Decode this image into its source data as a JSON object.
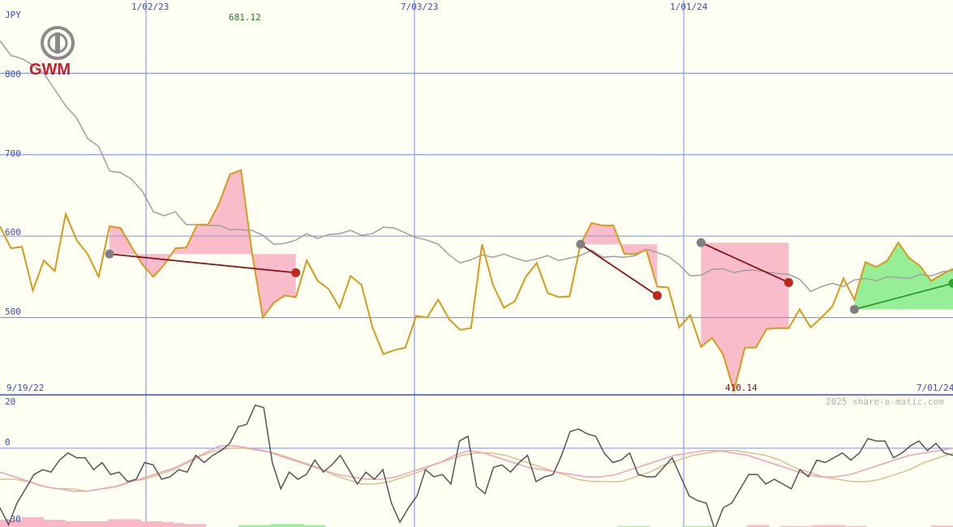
{
  "chart_data": [
    {
      "type": "line",
      "currency": "JPY",
      "x_tick_labels": [
        "1/02/23",
        "7/03/23",
        "1/01/24"
      ],
      "range_start_label": "9/19/22",
      "range_end_label": "7/01/24",
      "y_tick_labels": [
        "800",
        "700",
        "600",
        "500"
      ],
      "ylim": [
        405,
        890
      ],
      "high_label": "681.12",
      "low_label": "410.14",
      "watermark": "2025 share-o-matic.com",
      "grid": true,
      "colors": {
        "price": "#d99a1a",
        "average": "#a0a0a0",
        "gain_fill": "#90ee90",
        "loss_fill": "#f8b8c8",
        "loss_line": "#8b1010",
        "gain_line": "#2a9a2a",
        "grid": "#8a9cf0",
        "axis_text": "#3c4cc0",
        "background": "#fffff4"
      },
      "series": [
        {
          "values": [
            612,
            585,
            587,
            533,
            570,
            557,
            627,
            595,
            578,
            550,
            612,
            610,
            587,
            565,
            550,
            565,
            585,
            586,
            614,
            614,
            640,
            676,
            681,
            580,
            500,
            518,
            527,
            525,
            570,
            545,
            535,
            512,
            551,
            540,
            488,
            455,
            460,
            463,
            502,
            500,
            522,
            498,
            485,
            487,
            590,
            540,
            512,
            520,
            550,
            567,
            530,
            525,
            526,
            590,
            616,
            613,
            613,
            578,
            578,
            583,
            538,
            537,
            488,
            503,
            464,
            475,
            455,
            410,
            463,
            463,
            486,
            487,
            487,
            510,
            488,
            500,
            514,
            548,
            522,
            568,
            562,
            570,
            592,
            573,
            563,
            545,
            553,
            560
          ]
        },
        {
          "values": [
            840,
            822,
            818,
            810,
            800,
            780,
            760,
            745,
            720,
            710,
            680,
            678,
            670,
            655,
            630,
            625,
            630,
            614,
            614,
            613,
            613,
            608,
            608,
            607,
            601,
            590,
            591,
            595,
            603,
            597,
            602,
            603,
            607,
            601,
            603,
            611,
            610,
            604,
            598,
            595,
            590,
            577,
            567,
            571,
            577,
            574,
            578,
            573,
            569,
            572,
            576,
            570,
            573,
            576,
            583,
            574,
            575,
            574,
            576,
            584,
            580,
            575,
            565,
            551,
            552,
            559,
            560,
            555,
            558,
            558,
            556,
            554,
            553,
            547,
            532,
            538,
            542,
            538,
            546,
            548,
            545,
            550,
            549,
            548,
            553,
            551,
            556,
            558
          ]
        }
      ],
      "trades": [
        {
          "entry_index": 10,
          "entry_value": 578,
          "exit_index": 27,
          "exit_value": 555,
          "result": "loss"
        },
        {
          "entry_index": 53,
          "entry_value": 590,
          "exit_index": 60,
          "exit_value": 527,
          "result": "loss"
        },
        {
          "entry_index": 64,
          "entry_value": 592,
          "exit_index": 72,
          "exit_value": 543,
          "result": "loss"
        },
        {
          "entry_index": 78,
          "entry_value": 510,
          "exit_index": 88,
          "exit_value": 542,
          "result": "gain"
        }
      ]
    },
    {
      "type": "line",
      "y_tick_labels": [
        "20",
        "0",
        "-30"
      ],
      "ylim": [
        -33,
        22
      ],
      "colors": {
        "oscillator": "#555555",
        "signal_pink": "#f5a0b8",
        "signal_tan": "#d8c090"
      },
      "series": [
        {
          "values": [
            -25,
            -32,
            -23,
            -17,
            -11,
            -9,
            -10,
            -5,
            -2,
            -4,
            -4,
            -9,
            -6,
            -11,
            -10,
            -14,
            -13,
            -6,
            -7,
            -13,
            -12,
            -9,
            -10,
            -3,
            -6,
            -3,
            -1,
            2,
            9,
            10,
            18,
            17,
            -6,
            -17,
            -10,
            -13,
            -11,
            -5,
            -10,
            -7,
            -3,
            -9,
            -15,
            -10,
            -13,
            -9,
            -23,
            -31,
            -25,
            -20,
            -9,
            -12,
            -11,
            -15,
            3,
            5,
            -16,
            -19,
            -8,
            -7,
            -10,
            -6,
            -3,
            -14,
            -12,
            -11,
            -3,
            7,
            8,
            6,
            5,
            -2,
            -6,
            -5,
            -2,
            -11,
            -12,
            -12,
            -8,
            -4,
            -12,
            -20,
            -22,
            -23,
            -34,
            -25,
            -23,
            -17,
            -11,
            -11,
            -15,
            -13,
            -15,
            -17,
            -9,
            -12,
            -5,
            -6,
            -4,
            -2,
            -5,
            -2,
            4,
            3,
            3,
            -4,
            -2,
            1,
            3,
            -1,
            2,
            -2,
            -3
          ]
        },
        {
          "values": [
            -10,
            -12,
            -14,
            -16,
            -17,
            -18,
            -18,
            -17,
            -16,
            -14,
            -12,
            -10,
            -8,
            -5,
            -2,
            1,
            1,
            0,
            -1,
            -3,
            -5,
            -7,
            -9,
            -11,
            -12,
            -13,
            -13,
            -12,
            -10,
            -8,
            -6,
            -3,
            -1,
            -2,
            -4,
            -6,
            -8,
            -9,
            -10,
            -11,
            -12,
            -12,
            -11,
            -9,
            -7,
            -5,
            -3,
            -2,
            -1,
            -1,
            -2,
            -3,
            -5,
            -7,
            -9,
            -11,
            -12,
            -12,
            -11,
            -9,
            -7,
            -5,
            -3,
            -2,
            -1,
            0
          ]
        },
        {
          "values": [
            -13,
            -13,
            -14,
            -16,
            -17,
            -17,
            -18,
            -17,
            -16,
            -14,
            -13,
            -11,
            -9,
            -6,
            -3,
            -1,
            0,
            0,
            -1,
            -2,
            -4,
            -6,
            -8,
            -11,
            -13,
            -15,
            -15,
            -14,
            -12,
            -10,
            -7,
            -5,
            -3,
            -2,
            -2,
            -3,
            -5,
            -7,
            -9,
            -11,
            -13,
            -14,
            -14,
            -14,
            -12,
            -10,
            -7,
            -5,
            -3,
            -2,
            -1,
            -1,
            -2,
            -3,
            -5,
            -8,
            -10,
            -12,
            -13,
            -14,
            -14,
            -13,
            -11,
            -9,
            -6,
            -4,
            -2
          ]
        }
      ],
      "histogram": [
        {
          "index": 0,
          "value": -15
        },
        {
          "index": 1,
          "value": -15
        },
        {
          "index": 2,
          "value": -20
        },
        {
          "index": 3,
          "value": -20
        },
        {
          "index": 4,
          "value": -15
        },
        {
          "index": 5,
          "value": -15
        },
        {
          "index": 6,
          "value": -12
        },
        {
          "index": 7,
          "value": -12
        },
        {
          "index": 8,
          "value": -12
        },
        {
          "index": 9,
          "value": -12
        },
        {
          "index": 10,
          "value": -16
        },
        {
          "index": 11,
          "value": -16
        },
        {
          "index": 12,
          "value": -16
        },
        {
          "index": 13,
          "value": -12
        },
        {
          "index": 14,
          "value": -12
        },
        {
          "index": 15,
          "value": -10
        },
        {
          "index": 16,
          "value": -8
        },
        {
          "index": 17,
          "value": -6
        },
        {
          "index": 18,
          "value": -6
        },
        {
          "index": 22,
          "value": 4
        },
        {
          "index": 23,
          "value": 4
        },
        {
          "index": 24,
          "value": 4
        },
        {
          "index": 25,
          "value": 6
        },
        {
          "index": 26,
          "value": 6
        },
        {
          "index": 27,
          "value": 6
        },
        {
          "index": 28,
          "value": 4
        },
        {
          "index": 29,
          "value": 4
        },
        {
          "index": 57,
          "value": 2
        },
        {
          "index": 58,
          "value": 2
        },
        {
          "index": 59,
          "value": 2
        },
        {
          "index": 63,
          "value": 2
        },
        {
          "index": 64,
          "value": 2
        },
        {
          "index": 65,
          "value": 2
        },
        {
          "index": 69,
          "value": -4
        },
        {
          "index": 70,
          "value": -4
        },
        {
          "index": 72,
          "value": -2
        },
        {
          "index": 73,
          "value": -2
        },
        {
          "index": 74,
          "value": -2
        },
        {
          "index": 75,
          "value": -4
        },
        {
          "index": 76,
          "value": -4
        },
        {
          "index": 77,
          "value": -4
        },
        {
          "index": 78,
          "value": -2
        },
        {
          "index": 79,
          "value": -2
        },
        {
          "index": 86,
          "value": -3
        },
        {
          "index": 87,
          "value": -3
        }
      ]
    }
  ],
  "logo": {
    "text": "GWM",
    "color": "#cc1b2a",
    "emblem_color": "#8a8a8a",
    "icon": "gwm-logo-emblem"
  }
}
